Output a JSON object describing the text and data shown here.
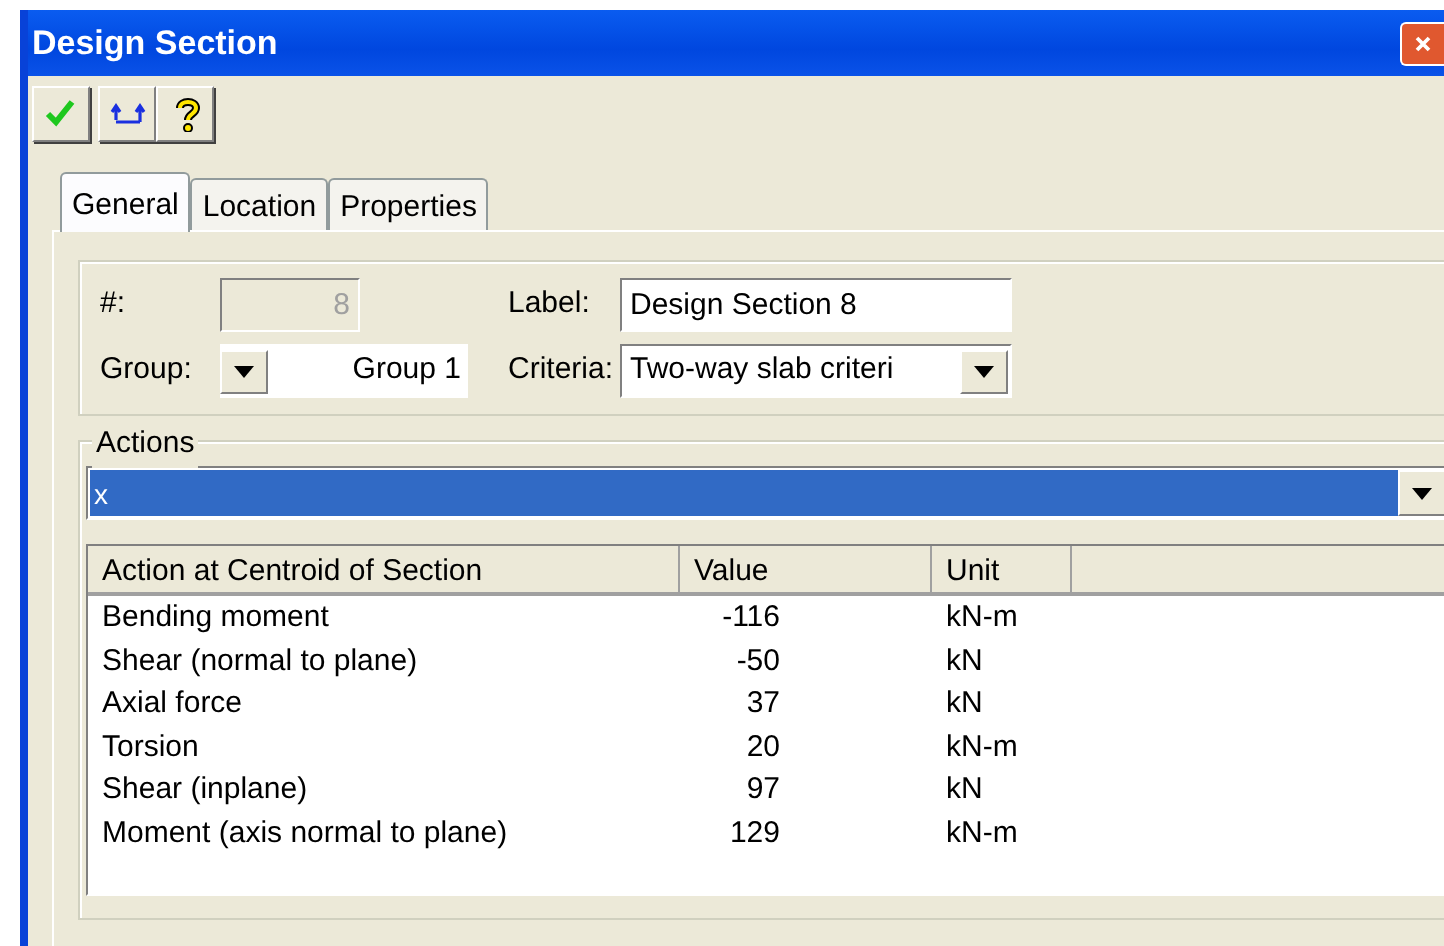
{
  "window": {
    "title": "Design Section"
  },
  "toolbar": [
    {
      "kind": "ok"
    },
    {
      "kind": "export"
    },
    {
      "kind": "help"
    }
  ],
  "tabs": [
    {
      "label": "General",
      "selected": true
    },
    {
      "label": "Location",
      "selected": false
    },
    {
      "label": "Properties",
      "selected": false
    }
  ],
  "general": {
    "number_label": "#:",
    "number_value": "8",
    "number_disabled": true,
    "label_label": "Label:",
    "label_value": "Design Section 8",
    "group_label": "Group:",
    "group_value": "Group 1",
    "criteria_label": "Criteria:",
    "criteria_value": "Two-way slab criteri"
  },
  "actions": {
    "title": "Actions",
    "selector_value": "x",
    "table": {
      "columns": [
        "Action at Centroid of Section",
        "Value",
        "Unit"
      ],
      "rows": [
        [
          "Bending moment",
          "-116",
          "kN-m"
        ],
        [
          "Shear (normal to plane)",
          "-50",
          "kN"
        ],
        [
          "Axial force",
          "37",
          "kN"
        ],
        [
          "Torsion",
          "20",
          "kN-m"
        ],
        [
          "Shear (inplane)",
          "97",
          "kN"
        ],
        [
          "Moment (axis normal to plane)",
          "129",
          "kN-m"
        ]
      ]
    }
  }
}
